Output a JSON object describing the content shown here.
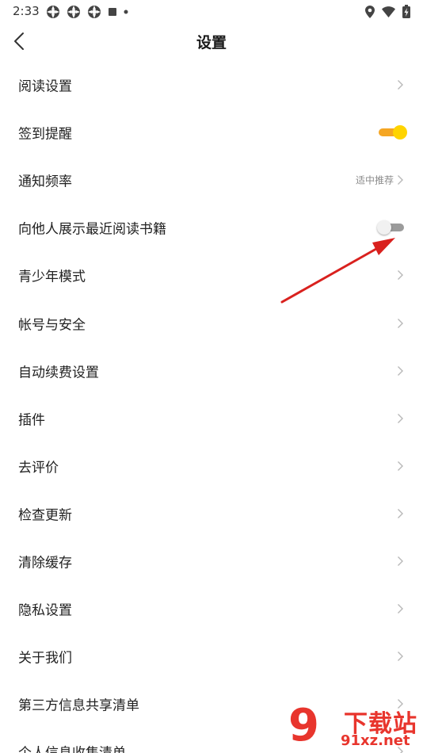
{
  "status_bar": {
    "time": "2:33"
  },
  "header": {
    "title": "设置"
  },
  "colors": {
    "toggle_on_knob": "#ffd400",
    "toggle_on_track": "#f5a623",
    "toggle_off_track": "#9b9b9b",
    "annotation_arrow": "#d9211e",
    "watermark": "#e8352d"
  },
  "settings": {
    "reading": {
      "label": "阅读设置"
    },
    "checkin": {
      "label": "签到提醒",
      "enabled": true
    },
    "notify_freq": {
      "label": "通知频率",
      "value": "适中推荐"
    },
    "show_recent": {
      "label": "向他人展示最近阅读书籍",
      "enabled": false
    },
    "teen_mode": {
      "label": "青少年模式"
    },
    "account": {
      "label": "帐号与安全"
    },
    "auto_renew": {
      "label": "自动续费设置"
    },
    "plugins": {
      "label": "插件"
    },
    "rate": {
      "label": "去评价"
    },
    "update": {
      "label": "检查更新"
    },
    "cache": {
      "label": "清除缓存"
    },
    "privacy": {
      "label": "隐私设置"
    },
    "about": {
      "label": "关于我们"
    },
    "third_party": {
      "label": "第三方信息共享清单"
    },
    "personal_info": {
      "label": "个人信息收集清单"
    }
  },
  "watermark": {
    "logo_glyph": "9",
    "title": "下载站",
    "url": "91xz.net"
  }
}
